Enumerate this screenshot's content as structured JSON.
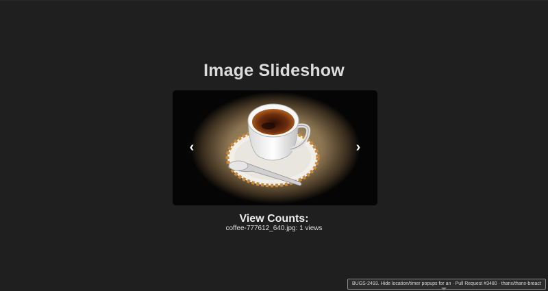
{
  "header": {
    "title": "Image Slideshow"
  },
  "slideshow": {
    "current_image": "coffee-777612_640.jpg",
    "prev_label": "‹",
    "next_label": "›"
  },
  "view_counts": {
    "heading": "View Counts:",
    "items": [
      {
        "text": "coffee-777612_640.jpg: 1 views"
      }
    ]
  },
  "tooltip": {
    "text": "BUGS-2493. Hide location/timer popups for   an · Pull Request #3480 · thanx/thanx-breact"
  }
}
